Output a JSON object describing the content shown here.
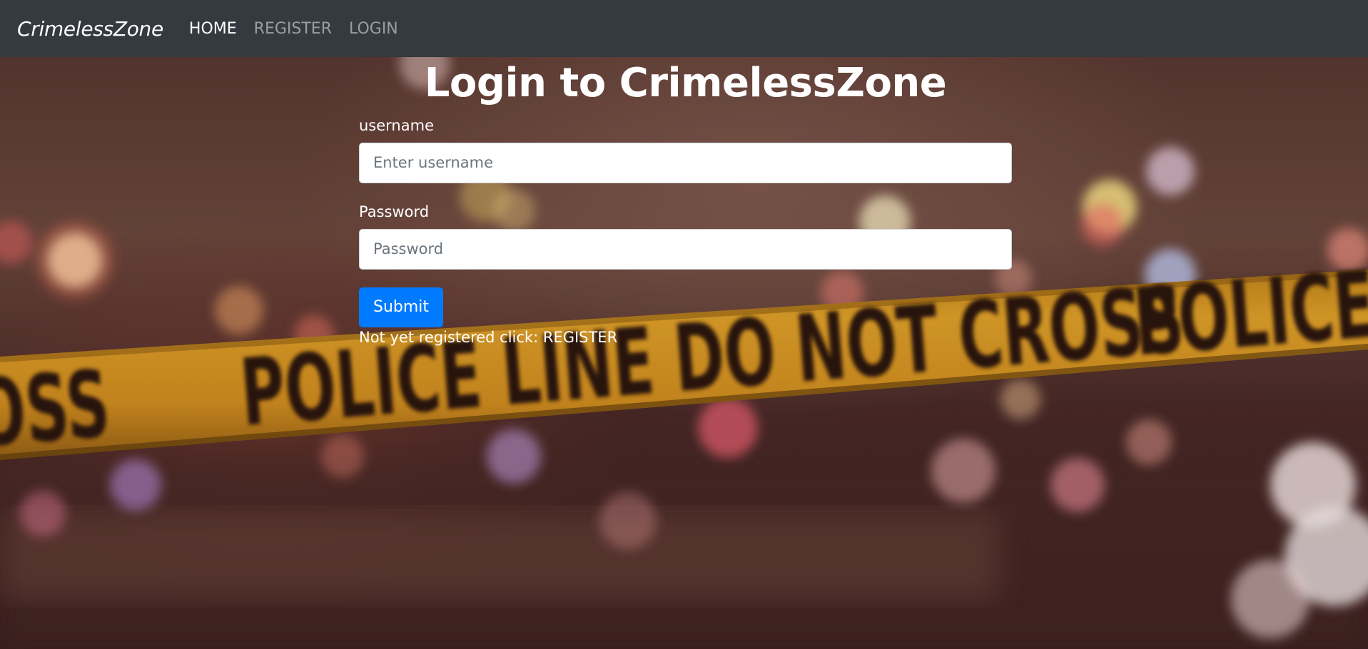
{
  "navbar": {
    "brand": "CrimelessZone",
    "links": [
      {
        "label": "HOME",
        "active": true
      },
      {
        "label": "REGISTER",
        "active": false
      },
      {
        "label": "LOGIN",
        "active": false
      }
    ]
  },
  "background": {
    "tape_text": "POLICE LINE DO NOT CROSS",
    "tape_color": "#e3a224"
  },
  "login": {
    "title": "Login to CrimelessZone",
    "username_label": "username",
    "username_placeholder": "Enter username",
    "password_label": "Password",
    "password_placeholder": "Password",
    "submit_label": "Submit",
    "register_prefix": "Not yet registered click: ",
    "register_link": "REGISTER",
    "submit_color": "#007bff"
  }
}
